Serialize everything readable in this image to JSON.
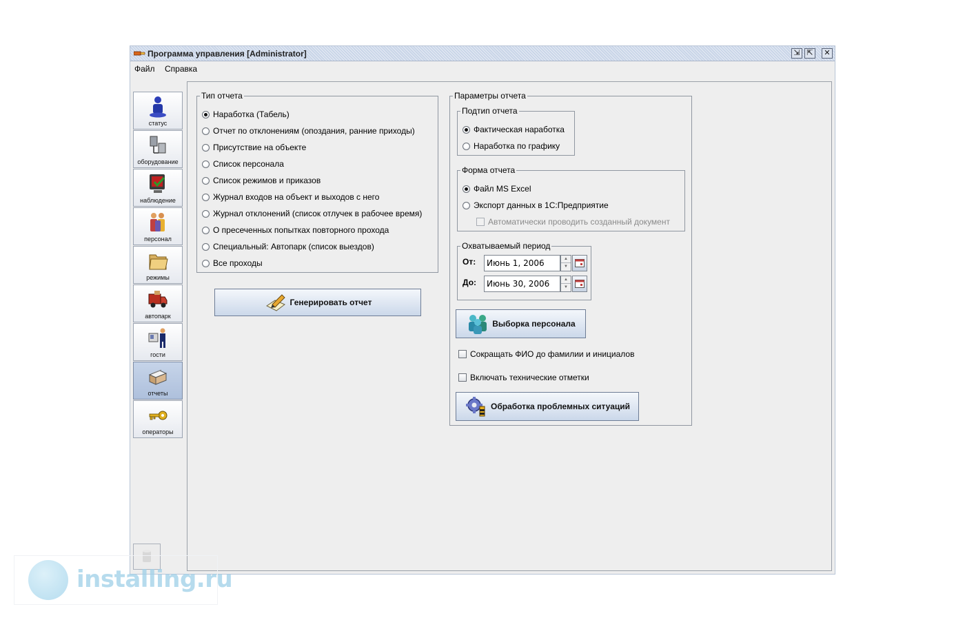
{
  "window": {
    "title": "Программа управления [Administrator]",
    "controls": {
      "restore": "⇲",
      "maximize": "⇱",
      "close": "✕"
    }
  },
  "menu": [
    {
      "label": "Файл"
    },
    {
      "label": "Справка"
    }
  ],
  "sidebar": {
    "items": [
      {
        "label": "статус",
        "icon": "person-status-icon",
        "active": false
      },
      {
        "label": "оборудование",
        "icon": "equipment-icon",
        "active": false
      },
      {
        "label": "наблюдение",
        "icon": "monitor-icon",
        "active": false
      },
      {
        "label": "персонал",
        "icon": "personnel-icon",
        "active": false
      },
      {
        "label": "режимы",
        "icon": "folder-icon",
        "active": false
      },
      {
        "label": "автопарк",
        "icon": "truck-icon",
        "active": false
      },
      {
        "label": "гости",
        "icon": "guest-icon",
        "active": false
      },
      {
        "label": "отчеты",
        "icon": "reports-icon",
        "active": true
      },
      {
        "label": "операторы",
        "icon": "key-icon",
        "active": false
      }
    ]
  },
  "report_type": {
    "title": "Тип отчета",
    "selected": 0,
    "options": [
      "Наработка (Табель)",
      "Отчет по отклонениям (опоздания, ранние приходы)",
      "Присутствие на объекте",
      "Список персонала",
      "Список режимов и приказов",
      "Журнал входов на объект и выходов с него",
      "Журнал отклонений (список отлучек в рабочее время)",
      "О пресеченных попытках повторного прохода",
      "Специальный: Автопарк (список выездов)",
      "Все проходы"
    ]
  },
  "generate_button": "Генерировать отчет",
  "report_params": {
    "title": "Параметры отчета",
    "subtype": {
      "title": "Подтип отчета",
      "selected": 0,
      "options": [
        "Фактическая наработка",
        "Наработка по графику"
      ]
    },
    "form": {
      "title": "Форма отчета",
      "selected": 0,
      "options": [
        "Файл MS Excel",
        "Экспорт данных в 1С:Предприятие"
      ],
      "auto_post_label": "Автоматически проводить созданный документ",
      "auto_post_checked": false,
      "auto_post_enabled": false
    },
    "period": {
      "title": "Охватываемый период",
      "from_label": "От:",
      "from_value": "Июнь 1, 2006",
      "to_label": "До:",
      "to_value": "Июнь 30, 2006"
    },
    "select_personnel_button": "Выборка персонала",
    "shorten_names_label": "Сокращать ФИО до фамилии и инициалов",
    "shorten_names_checked": false,
    "include_tech_marks_label": "Включать технические отметки",
    "include_tech_marks_checked": false,
    "problem_situations_button": "Обработка проблемных ситуаций"
  },
  "watermark": "installing.ru"
}
